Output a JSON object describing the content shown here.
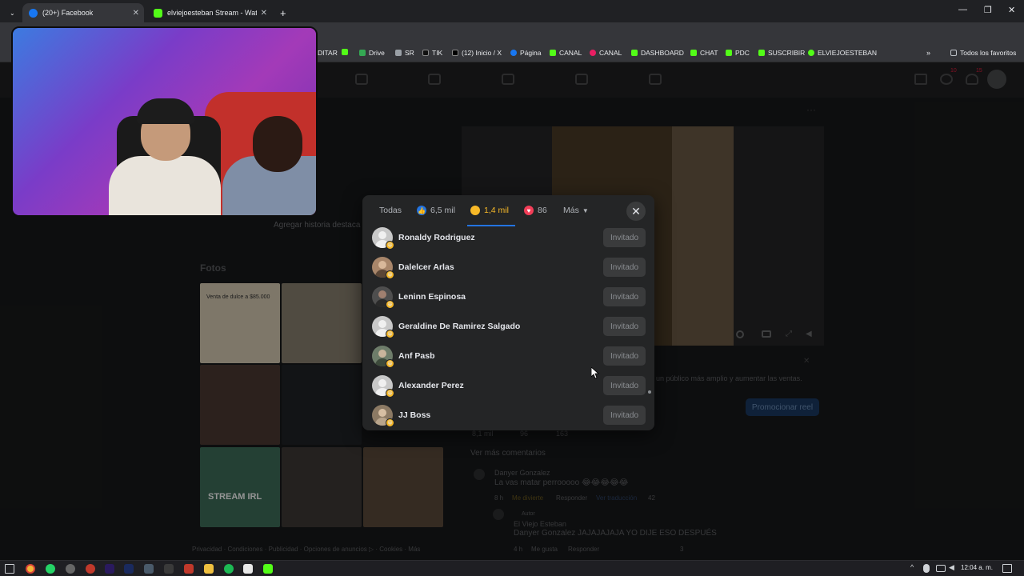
{
  "browser": {
    "tabs": [
      {
        "title": "(20+) Facebook",
        "active": true
      },
      {
        "title": "elviejoesteban Stream - Watch",
        "active": false
      }
    ],
    "bookmarks": [
      "DITAR",
      "Drive",
      "SR",
      "TIK",
      "(12) Inicio / X",
      "Página",
      "CANAL",
      "CANAL",
      "DASHBOARD",
      "CHAT",
      "PDC",
      "SUSCRIBIR",
      "ELVIEJOESTEBAN"
    ],
    "all_bookmarks_label": "Todos los favoritos"
  },
  "facebook": {
    "nav_badges": {
      "messages": "10",
      "notifications": "15"
    },
    "featured_story": "Agregar historia destaca",
    "photos_title": "Fotos",
    "promo_text": "un público más amplio y aumentar las ventas.",
    "promote_button": "Promocionar reel",
    "post_stats": {
      "likes": "8,1 mil",
      "comments": "96",
      "shares": "163"
    },
    "see_more_comments": "Ver más comentarios",
    "comments": [
      {
        "author": "Danyer Gonzalez",
        "text": "La vas matar perrooooo 😂😂😂😂😂",
        "time": "8 h",
        "reaction": "Me divierte",
        "reply": "Responder",
        "extra": "Ver traducción",
        "count": "42"
      },
      {
        "author": "El Viejo Esteban",
        "tag": "Autor",
        "text": "Danyer Gonzalez JAJAJAJAJA YO DIJE ESO DESPUÉS",
        "time": "4 h",
        "reaction": "Me gusta",
        "reply": "Responder",
        "count": "3"
      }
    ],
    "footer": "Privacidad · Condiciones · Publicidad · Opciones de anuncios ▷ · Cookies · Más",
    "photo_captions": [
      "Venta de dulce a $85.000",
      "STREAM IRL"
    ]
  },
  "reactions_modal": {
    "tabs": [
      {
        "label": "Todas",
        "icon": ""
      },
      {
        "label": "6,5 mil",
        "icon": "like-icon",
        "color": "#2374e1"
      },
      {
        "label": "1,4 mil",
        "icon": "haha-icon",
        "color": "#f7b928"
      },
      {
        "label": "86",
        "icon": "love-icon",
        "color": "#f33e58"
      },
      {
        "label": "Más",
        "icon": "chevron-down-icon"
      }
    ],
    "active_tab_index": 2,
    "people": [
      {
        "name": "Ronaldy Rodriguez",
        "button": "Invitado"
      },
      {
        "name": "Dalelcer Arlas",
        "button": "Invitado"
      },
      {
        "name": "Leninn Espinosa",
        "button": "Invitado"
      },
      {
        "name": "Geraldine De Ramirez Salgado",
        "button": "Invitado"
      },
      {
        "name": "Anf Pasb",
        "button": "Invitado"
      },
      {
        "name": "Alexander Perez",
        "button": "Invitado"
      },
      {
        "name": "JJ Boss",
        "button": "Invitado"
      }
    ]
  },
  "taskbar": {
    "time": "12:04 a. m."
  }
}
